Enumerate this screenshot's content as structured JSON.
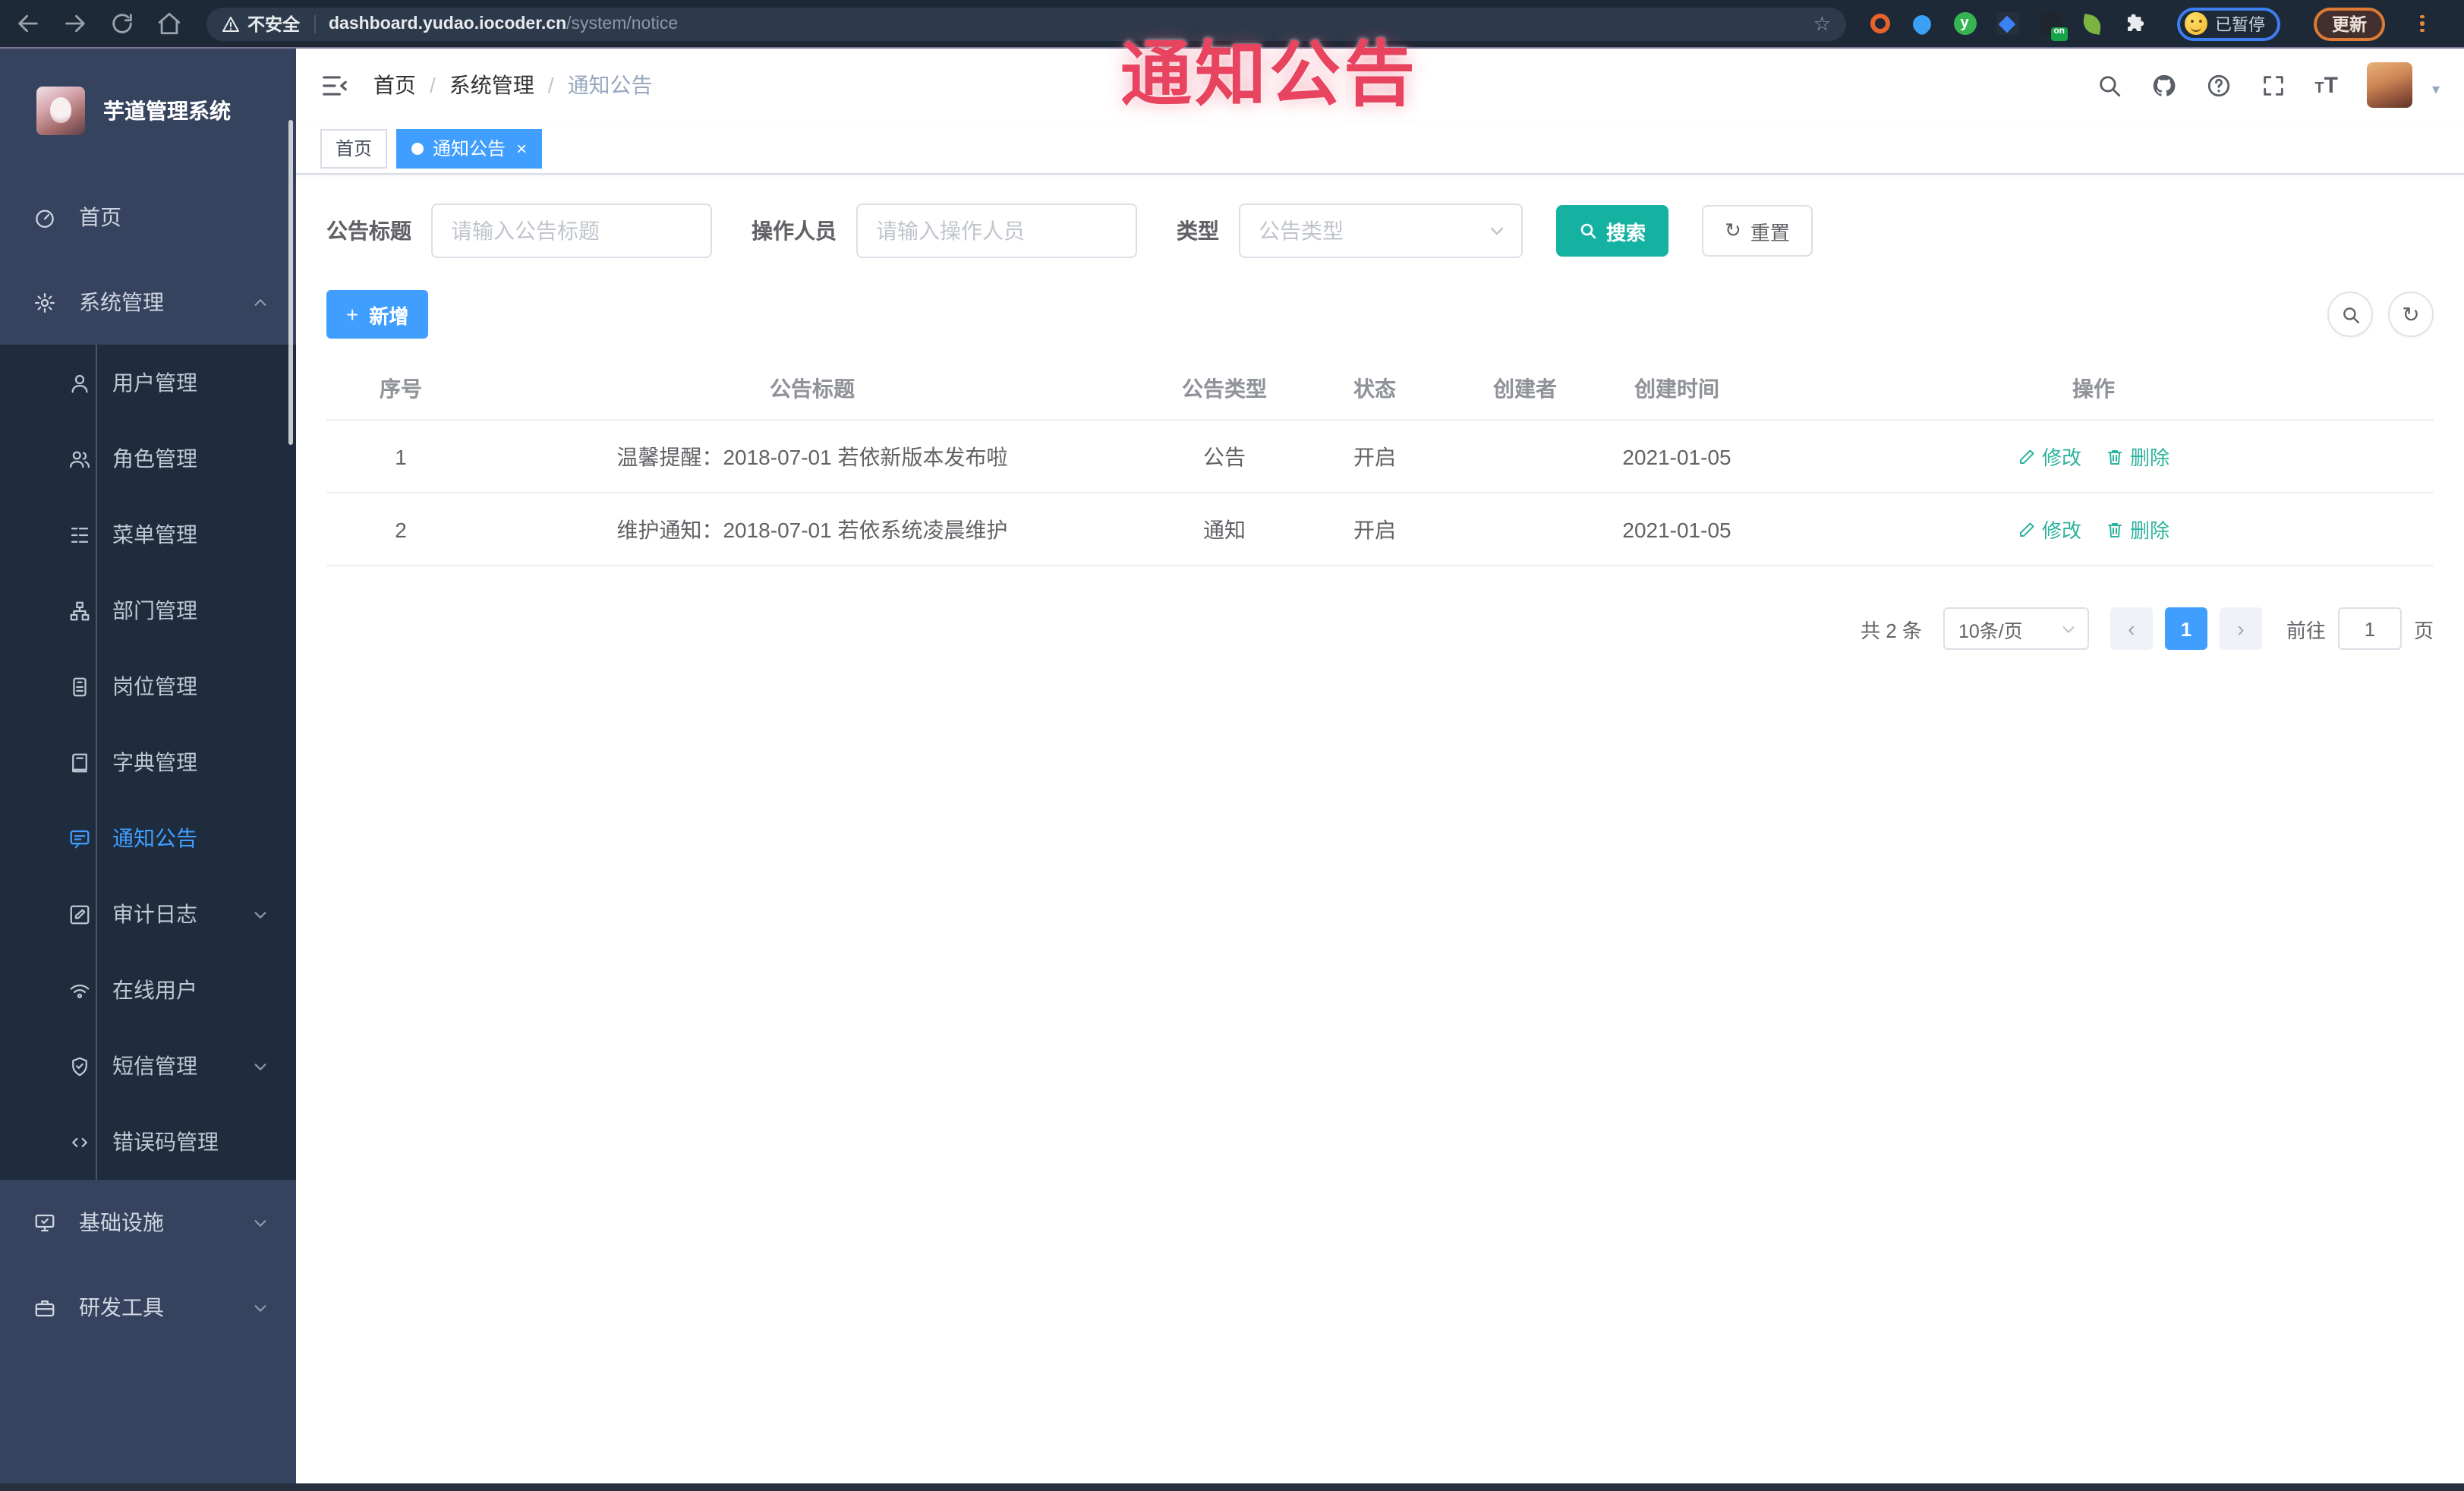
{
  "colors": {
    "primary": "#409eff",
    "search_teal": "#15b2a2",
    "action_teal": "#2cb39c",
    "overlay_red": "#e8435f",
    "sidebar_bg": "#36435e",
    "submenu_bg": "#1f2c3d",
    "browser_bar": "#1d2936"
  },
  "overlay": {
    "text": "通知公告"
  },
  "browser": {
    "security_label": "不安全",
    "url_host": "dashboard.yudao.iocoder.cn",
    "url_path": "/system/notice",
    "star_glyph": "☆",
    "extension_badge": "on",
    "extension_y_label": "y",
    "profile_label": "已暂停",
    "update_label": "更新"
  },
  "sidebar": {
    "title": "芋道管理系统",
    "items": [
      {
        "label": "首页",
        "icon": "dashboard-icon"
      },
      {
        "label": "系统管理",
        "icon": "gear-icon",
        "expanded": true
      },
      {
        "label": "用户管理",
        "icon": "user-icon"
      },
      {
        "label": "角色管理",
        "icon": "users-icon"
      },
      {
        "label": "菜单管理",
        "icon": "menu-list-icon"
      },
      {
        "label": "部门管理",
        "icon": "org-tree-icon"
      },
      {
        "label": "岗位管理",
        "icon": "id-badge-icon"
      },
      {
        "label": "字典管理",
        "icon": "dictionary-icon"
      },
      {
        "label": "通知公告",
        "icon": "notice-icon",
        "active": true
      },
      {
        "label": "审计日志",
        "icon": "log-icon",
        "collapsed": true
      },
      {
        "label": "在线用户",
        "icon": "online-icon"
      },
      {
        "label": "短信管理",
        "icon": "shield-icon",
        "collapsed": true
      },
      {
        "label": "错误码管理",
        "icon": "code-icon"
      },
      {
        "label": "基础设施",
        "icon": "monitor-icon",
        "collapsed": true
      },
      {
        "label": "研发工具",
        "icon": "toolbox-icon",
        "collapsed": true
      }
    ]
  },
  "header": {
    "breadcrumb": [
      "首页",
      "系统管理",
      "通知公告"
    ],
    "separator": "/",
    "font_size_glyph_small": "T",
    "font_size_glyph_big": "T",
    "caret_glyph": "▾"
  },
  "tags": {
    "home_label": "首页",
    "active_label": "通知公告",
    "close_glyph": "×"
  },
  "filters": {
    "title_label": "公告标题",
    "title_placeholder": "请输入公告标题",
    "operator_label": "操作人员",
    "operator_placeholder": "请输入操作人员",
    "type_label": "类型",
    "type_placeholder": "公告类型",
    "search_label": "搜索",
    "reset_label": "重置",
    "reset_glyph": "↻"
  },
  "toolbar": {
    "add_label": "新增",
    "plus_glyph": "+",
    "refresh_glyph": "↻"
  },
  "table": {
    "columns": [
      "序号",
      "公告标题",
      "公告类型",
      "状态",
      "创建者",
      "创建时间",
      "操作"
    ],
    "rows": [
      {
        "index": "1",
        "title": "温馨提醒：2018-07-01 若依新版本发布啦",
        "type": "公告",
        "status": "开启",
        "creator": "",
        "created": "2021-01-05"
      },
      {
        "index": "2",
        "title": "维护通知：2018-07-01 若依系统凌晨维护",
        "type": "通知",
        "status": "开启",
        "creator": "",
        "created": "2021-01-05"
      }
    ],
    "edit_label": "修改",
    "delete_label": "删除"
  },
  "pagination": {
    "total_label": "共 2 条",
    "page_size": "10条/页",
    "prev_glyph": "‹",
    "next_glyph": "›",
    "current_page": "1",
    "goto_label": "前往",
    "goto_value": "1",
    "page_unit": "页"
  }
}
